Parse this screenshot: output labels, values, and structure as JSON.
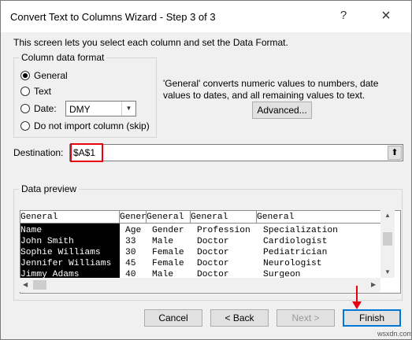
{
  "window": {
    "title": "Convert Text to Columns Wizard - Step 3 of 3",
    "help": "?",
    "close": "×"
  },
  "intro": "This screen lets you select each column and set the Data Format.",
  "format_group": {
    "title": "Column data format",
    "options": [
      "General",
      "Text",
      "Date:",
      "Do not import column (skip)"
    ],
    "selected": "General",
    "date_value": "DMY"
  },
  "description": "'General' converts numeric values to numbers, date values to dates, and all remaining values to text.",
  "advanced_label": "Advanced...",
  "destination": {
    "label": "Destination:",
    "value": "$A$1"
  },
  "preview": {
    "title": "Data preview",
    "headers": [
      "General",
      "Gener",
      "General",
      "General",
      "General"
    ],
    "rows": [
      [
        "Name",
        "Age",
        "Gender",
        "Profession",
        "Specialization"
      ],
      [
        "John Smith",
        "33",
        "Male",
        "Doctor",
        "Cardiologist"
      ],
      [
        "Sophie Williams",
        "30",
        "Female",
        "Doctor",
        "Pediatrician"
      ],
      [
        "Jennifer Williams",
        "45",
        "Female",
        "Doctor",
        "Neurologist"
      ],
      [
        "Jimmy Adams",
        "40",
        "Male",
        "Doctor",
        "Surgeon"
      ]
    ]
  },
  "buttons": {
    "cancel": "Cancel",
    "back": "< Back",
    "next": "Next >",
    "finish": "Finish"
  },
  "highlight_color": "#e8000f",
  "watermark": "wsxdn.com"
}
